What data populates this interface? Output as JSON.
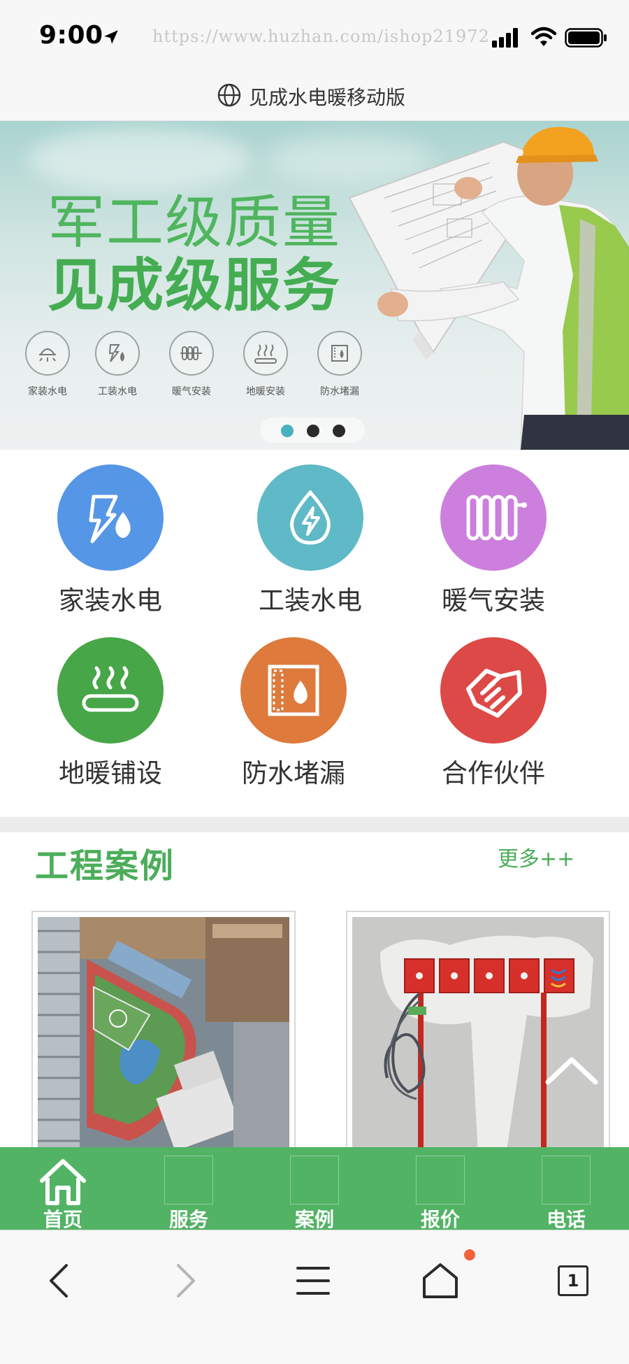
{
  "status_bar": {
    "time": "9:00",
    "url": "https://www.huzhan.com/ishop21972"
  },
  "header": {
    "title": "见成水电暖移动版"
  },
  "banner": {
    "headline_1": "军工级质量",
    "headline_2": "见成级服务",
    "services": [
      {
        "label": "家装水电",
        "icon": "lamp-icon"
      },
      {
        "label": "工装水电",
        "icon": "bolt-drop-icon"
      },
      {
        "label": "暖气安装",
        "icon": "radiator-icon"
      },
      {
        "label": "地暖安装",
        "icon": "floor-heat-icon"
      },
      {
        "label": "防水堵漏",
        "icon": "waterproof-icon"
      }
    ],
    "slide_count": 3,
    "active_slide": 1
  },
  "categories": [
    {
      "label": "家装水电",
      "icon": "bolt-drop-icon",
      "color": "#5596e6"
    },
    {
      "label": "工装水电",
      "icon": "drop-bolt-icon",
      "color": "#5fb9c6"
    },
    {
      "label": "暖气安装",
      "icon": "radiator-icon",
      "color": "#cc7fdc"
    },
    {
      "label": "地暖铺设",
      "icon": "floor-heat-icon",
      "color": "#47a648"
    },
    {
      "label": "防水堵漏",
      "icon": "waterproof-icon",
      "color": "#dd7a3c"
    },
    {
      "label": "合作伙伴",
      "icon": "handshake-icon",
      "color": "#dc4946"
    }
  ],
  "section": {
    "title": "工程案例",
    "more": "更多++"
  },
  "bottom_nav": [
    {
      "label": "首页",
      "icon": "home-icon"
    },
    {
      "label": "服务"
    },
    {
      "label": "案例"
    },
    {
      "label": "报价"
    },
    {
      "label": "电话"
    }
  ],
  "browser_toolbar": {
    "tab_count": "1"
  },
  "colors": {
    "brand_green": "#52b365",
    "section_green": "#4cad5a",
    "active_dot": "#4ab1c3",
    "notify": "#f0623a"
  }
}
